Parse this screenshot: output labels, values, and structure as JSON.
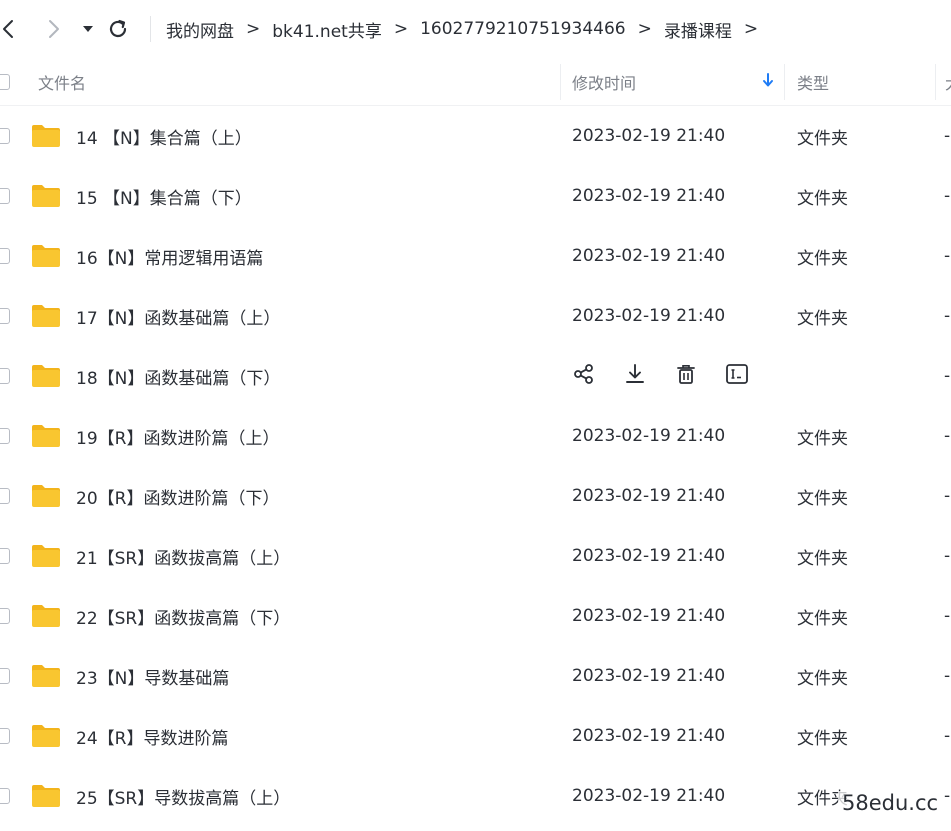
{
  "toolbar": {
    "back_icon": "chevron-left-icon",
    "forward_icon": "chevron-right-icon",
    "history_icon": "caret-down-icon",
    "refresh_icon": "refresh-icon"
  },
  "breadcrumb": {
    "items": [
      "我的网盘",
      "bk41.net共享",
      "1602779210751934466",
      "录播课程"
    ],
    "separator": ">"
  },
  "columns": {
    "name": "文件名",
    "modified": "修改时间",
    "type": "类型",
    "size_partial": "大"
  },
  "sort": {
    "column": "modified",
    "direction": "down",
    "icon": "arrow-down-icon",
    "color": "#1f7cf5"
  },
  "colors": {
    "folder": "#f9c630",
    "folder_dark": "#f2b41c",
    "accent": "#1f7cf5"
  },
  "rows": [
    {
      "name": "14 【N】集合篇（上）",
      "modified": "2023-02-19 21:40",
      "type": "文件夹",
      "size": "-"
    },
    {
      "name": "15 【N】集合篇（下）",
      "modified": "2023-02-19 21:40",
      "type": "文件夹",
      "size": "-"
    },
    {
      "name": "16【N】常用逻辑用语篇",
      "modified": "2023-02-19 21:40",
      "type": "文件夹",
      "size": "-"
    },
    {
      "name": "17【N】函数基础篇（上）",
      "modified": "2023-02-19 21:40",
      "type": "文件夹",
      "size": "-"
    },
    {
      "name": "18【N】函数基础篇（下）",
      "modified": "",
      "type": "",
      "size": "-",
      "hovered": true
    },
    {
      "name": "19【R】函数进阶篇（上）",
      "modified": "2023-02-19 21:40",
      "type": "文件夹",
      "size": "-"
    },
    {
      "name": "20【R】函数进阶篇（下）",
      "modified": "2023-02-19 21:40",
      "type": "文件夹",
      "size": "-"
    },
    {
      "name": "21【SR】函数拔高篇（上）",
      "modified": "2023-02-19 21:40",
      "type": "文件夹",
      "size": "-"
    },
    {
      "name": "22【SR】函数拔高篇（下）",
      "modified": "2023-02-19 21:40",
      "type": "文件夹",
      "size": "-"
    },
    {
      "name": "23【N】导数基础篇",
      "modified": "2023-02-19 21:40",
      "type": "文件夹",
      "size": "-"
    },
    {
      "name": "24【R】导数进阶篇",
      "modified": "2023-02-19 21:40",
      "type": "文件夹",
      "size": "-"
    },
    {
      "name": "25【SR】导数拔高篇（上）",
      "modified": "2023-02-19 21:40",
      "type": "文件夹",
      "size": "-"
    }
  ],
  "hover_actions": [
    "share-icon",
    "download-icon",
    "delete-icon",
    "rename-icon"
  ],
  "watermark": "58edu.cc"
}
